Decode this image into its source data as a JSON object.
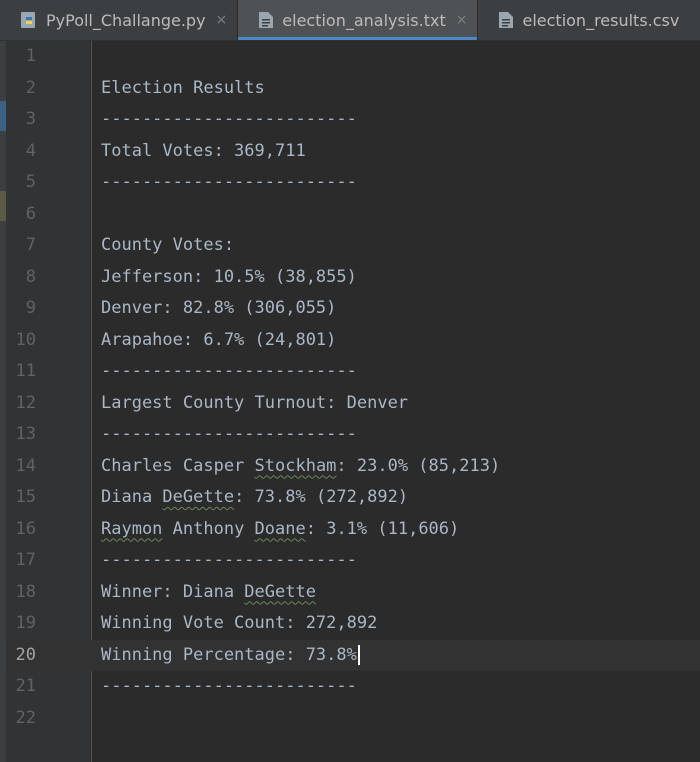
{
  "tabs": [
    {
      "label": "PyPoll_Challange.py",
      "icon": "python-file-icon",
      "active": false
    },
    {
      "label": "election_analysis.txt",
      "icon": "text-file-icon",
      "active": true
    },
    {
      "label": "election_results.csv",
      "icon": "csv-file-icon",
      "active": false
    }
  ],
  "close_glyph": "×",
  "editor": {
    "current_line": 20,
    "lines": [
      {
        "n": "1",
        "text": ""
      },
      {
        "n": "2",
        "text": "Election Results"
      },
      {
        "n": "3",
        "text": "-------------------------"
      },
      {
        "n": "4",
        "text": "Total Votes: 369,711"
      },
      {
        "n": "5",
        "text": "-------------------------"
      },
      {
        "n": "6",
        "text": ""
      },
      {
        "n": "7",
        "text": "County Votes:"
      },
      {
        "n": "8",
        "text": "Jefferson: 10.5% (38,855)"
      },
      {
        "n": "9",
        "text": "Denver: 82.8% (306,055)"
      },
      {
        "n": "10",
        "text": "Arapahoe: 6.7% (24,801)"
      },
      {
        "n": "11",
        "text": "-------------------------"
      },
      {
        "n": "12",
        "text": "Largest County Turnout: Denver"
      },
      {
        "n": "13",
        "text": "-------------------------"
      },
      {
        "n": "14",
        "text": "Charles Casper Stockham: 23.0% (85,213)"
      },
      {
        "n": "15",
        "text": "Diana DeGette: 73.8% (272,892)"
      },
      {
        "n": "16",
        "text": "Raymon Anthony Doane: 3.1% (11,606)"
      },
      {
        "n": "17",
        "text": "-------------------------"
      },
      {
        "n": "18",
        "text": "Winner: Diana DeGette"
      },
      {
        "n": "19",
        "text": "Winning Vote Count: 272,892"
      },
      {
        "n": "20",
        "text": "Winning Percentage: 73.8%"
      },
      {
        "n": "21",
        "text": "-------------------------"
      },
      {
        "n": "22",
        "text": ""
      }
    ]
  },
  "colors": {
    "background": "#2b2b2b",
    "text": "#a9b7c6",
    "line_number": "#606366",
    "tab_active_underline": "#4a88c7"
  }
}
